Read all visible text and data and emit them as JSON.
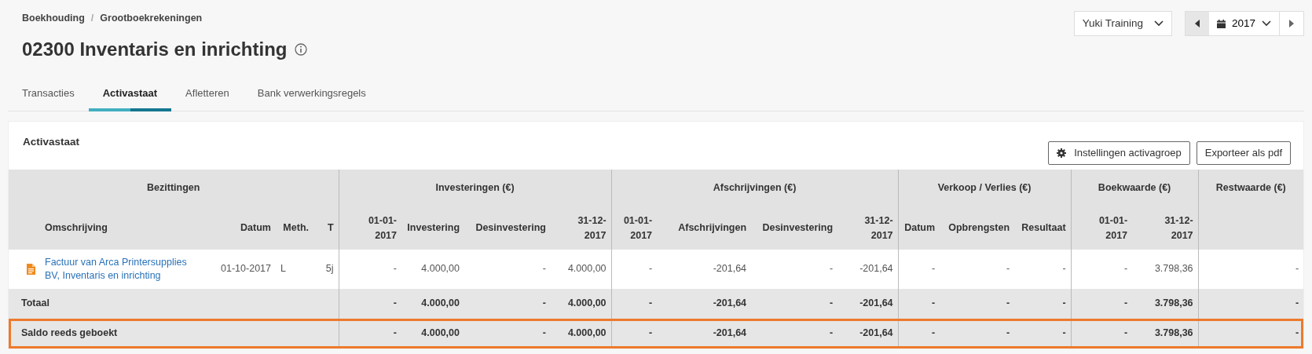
{
  "breadcrumb": {
    "separator": "/",
    "items": [
      {
        "label": "Boekhouding"
      },
      {
        "label": "Grootboekrekeningen"
      }
    ]
  },
  "title": "02300 Inventaris en inrichting",
  "company_select": {
    "value": "Yuki Training"
  },
  "year_picker": {
    "value": "2017"
  },
  "tabs": [
    {
      "label": "Transacties",
      "selected": false
    },
    {
      "label": "Activastaat",
      "selected": true
    },
    {
      "label": "Afletteren",
      "selected": false
    },
    {
      "label": "Bank verwerkingsregels",
      "selected": false
    }
  ],
  "card": {
    "title": "Activastaat",
    "buttons": [
      {
        "label": "Instellingen activagroep",
        "kind": "settings"
      },
      {
        "label": "Exporteer als pdf",
        "kind": "plain"
      }
    ]
  },
  "table": {
    "groups": [
      {
        "label": "Bezittingen",
        "columns": [
          "Omschrijving",
          "Datum",
          "Meth.",
          "T"
        ]
      },
      {
        "label": "Investeringen (€)",
        "columns": [
          "01-01-2017",
          "Investering",
          "Desinvestering",
          "31-12-2017"
        ]
      },
      {
        "label": "Afschrijvingen (€)",
        "columns": [
          "01-01-2017",
          "Afschrijvingen",
          "Desinvestering",
          "31-12-2017"
        ]
      },
      {
        "label": "Verkoop / Verlies (€)",
        "columns": [
          "Datum",
          "Opbrengsten",
          "Resultaat"
        ]
      },
      {
        "label": "Boekwaarde (€)",
        "columns": [
          "01-01-2017",
          "31-12-2017"
        ]
      },
      {
        "label": "Restwaarde (€)"
      }
    ],
    "rows": [
      {
        "kind": "asset",
        "description": "Factuur van Arca Printersupplies BV, Inventaris en inrichting",
        "date": "01-10-2017",
        "method": "L",
        "term": "5j",
        "highlighted": false,
        "values": [
          "-",
          "4.000,00",
          "-",
          "4.000,00",
          "-",
          "-201,64",
          "-",
          "-201,64",
          "-",
          "-",
          "-",
          "-",
          "3.798,36",
          "-"
        ]
      },
      {
        "kind": "total",
        "label": "Totaal",
        "highlighted": false,
        "values": [
          "-",
          "4.000,00",
          "-",
          "4.000,00",
          "-",
          "-201,64",
          "-",
          "-201,64",
          "-",
          "-",
          "-",
          "-",
          "3.798,36",
          "-"
        ]
      },
      {
        "kind": "total",
        "label": "Saldo reeds geboekt",
        "highlighted": true,
        "values": [
          "-",
          "4.000,00",
          "-",
          "4.000,00",
          "-",
          "-201,64",
          "-",
          "-201,64",
          "-",
          "-",
          "-",
          "-",
          "3.798,36",
          "-"
        ]
      }
    ]
  }
}
